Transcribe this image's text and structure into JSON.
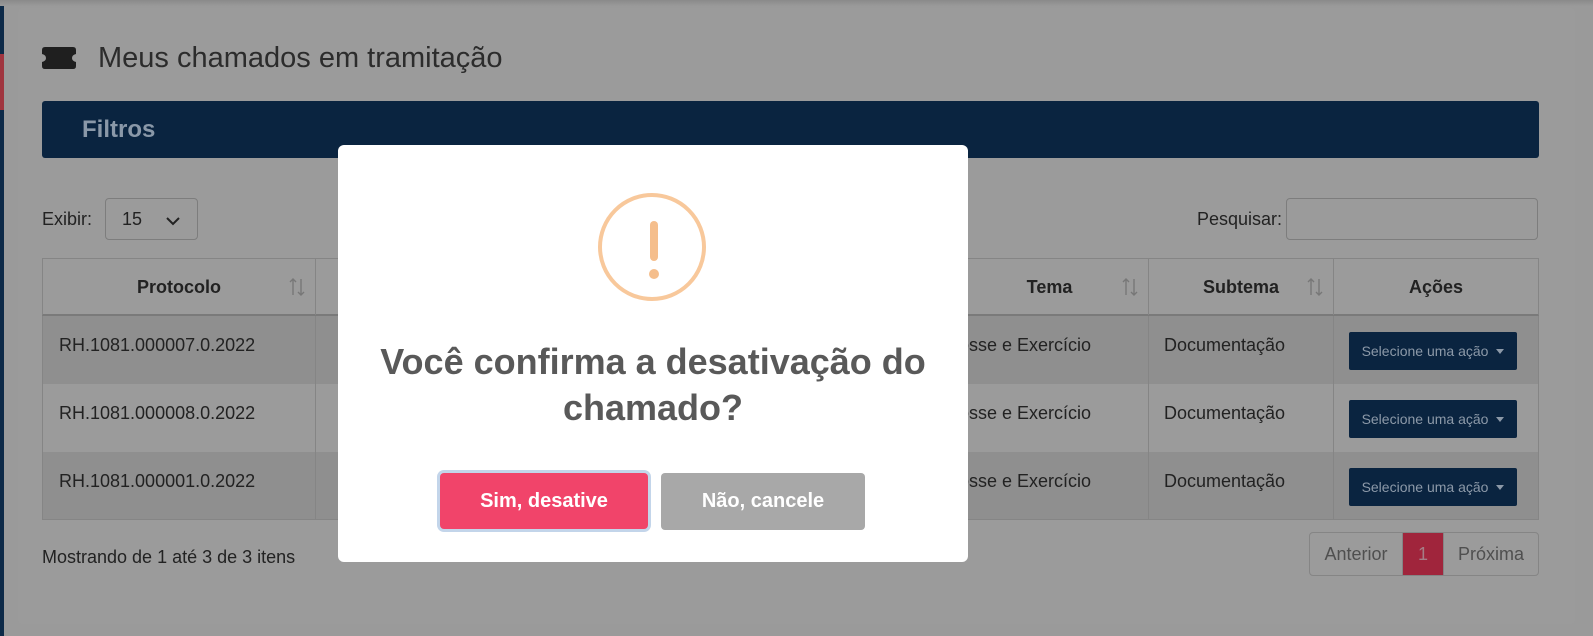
{
  "page": {
    "title": "Meus chamados em tramitação",
    "filters_label": "Filtros"
  },
  "controls": {
    "show_label": "Exibir:",
    "show_value": "15",
    "search_label": "Pesquisar:",
    "search_value": ""
  },
  "table": {
    "headers": {
      "protocolo": "Protocolo",
      "tema": "Tema",
      "subtema": "Subtema",
      "acoes": "Ações"
    },
    "rows": [
      {
        "protocolo": "RH.1081.000007.0.2022",
        "tema": "osse e Exercício",
        "subtema": "Documentação",
        "acao": "Selecione uma ação"
      },
      {
        "protocolo": "RH.1081.000008.0.2022",
        "tema": "osse e Exercício",
        "subtema": "Documentação",
        "acao": "Selecione uma ação"
      },
      {
        "protocolo": "RH.1081.000001.0.2022",
        "tema": "osse e Exercício",
        "subtema": "Documentação",
        "acao": "Selecione uma ação"
      }
    ]
  },
  "footer": {
    "showing": "Mostrando de 1 até 3 de 3 itens",
    "prev": "Anterior",
    "current_page": "1",
    "next": "Próxima"
  },
  "modal": {
    "icon": "warning-icon",
    "title": "Você confirma a desativação do chamado?",
    "confirm_label": "Sim, desative",
    "cancel_label": "Não, cancele"
  },
  "colors": {
    "navy": "#0a2440",
    "confirm": "#f1446a",
    "cancel": "#a8a8a8",
    "warning": "#f8c89b",
    "page_active": "#a0253c"
  }
}
